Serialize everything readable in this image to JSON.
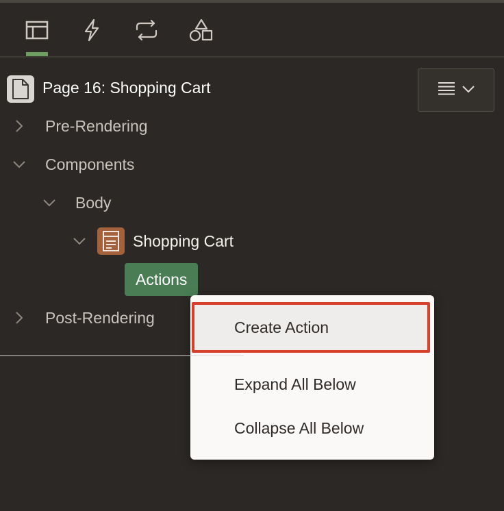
{
  "tabs": [
    {
      "icon": "layout-icon",
      "active": true
    },
    {
      "icon": "lightning-icon",
      "active": false
    },
    {
      "icon": "sync-icon",
      "active": false
    },
    {
      "icon": "shapes-icon",
      "active": false
    }
  ],
  "tree": {
    "page_title": "Page 16: Shopping Cart",
    "pre_rendering": "Pre-Rendering",
    "components": "Components",
    "body": "Body",
    "region": "Shopping Cart",
    "actions": "Actions",
    "post_rendering": "Post-Rendering"
  },
  "context_menu": {
    "items": [
      "Create Action",
      "Expand All Below",
      "Collapse All Below"
    ],
    "highlight_color": "#d7402a"
  },
  "colors": {
    "background": "#2b2825",
    "active_tab": "#6f9e62",
    "selected_node": "#4a7d54",
    "region_icon": "#a3623b"
  }
}
